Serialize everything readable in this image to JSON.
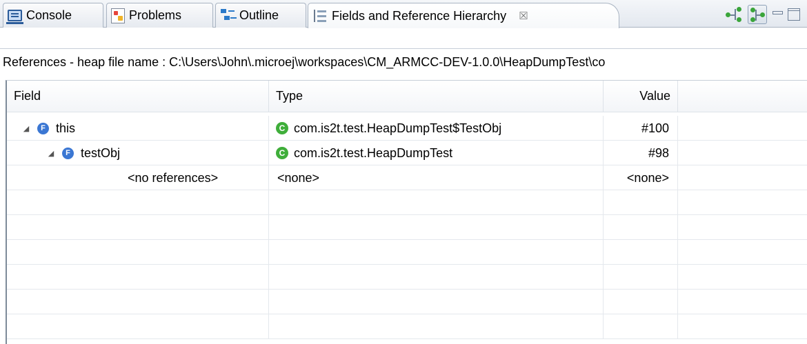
{
  "tabs": [
    {
      "label": "Console",
      "icon": "console-icon"
    },
    {
      "label": "Problems",
      "icon": "problems-icon"
    },
    {
      "label": "Outline",
      "icon": "outline-icon"
    },
    {
      "label": "Fields and Reference Hierarchy",
      "icon": "hierarchy-icon",
      "active": true,
      "close_glyph": "☒"
    }
  ],
  "toolbar": {
    "buttons": [
      "show-referencing-icon",
      "show-referenced-icon",
      "minimize-icon",
      "maximize-icon"
    ]
  },
  "path_text": "References - heap file name : C:\\Users\\John\\.microej\\workspaces\\CM_ARMCC-DEV-1.0.0\\HeapDumpTest\\co",
  "table": {
    "columns": [
      "Field",
      "Type",
      "Value"
    ],
    "rows": [
      {
        "twisty": "◢",
        "field_icon": "F",
        "field": "this",
        "type_icon": "C",
        "type": "com.is2t.test.HeapDumpTest$TestObj",
        "value": "#100"
      },
      {
        "twisty": "◢",
        "field_icon": "F",
        "field": "testObj",
        "type_icon": "C",
        "type": "com.is2t.test.HeapDumpTest",
        "value": "#98"
      },
      {
        "field": "<no references>",
        "type": "<none>",
        "value": "<none>"
      }
    ]
  },
  "colors": {
    "field_icon": "#3b77d3",
    "class_icon": "#3fae3a",
    "tab_border": "#a9b4c2"
  }
}
